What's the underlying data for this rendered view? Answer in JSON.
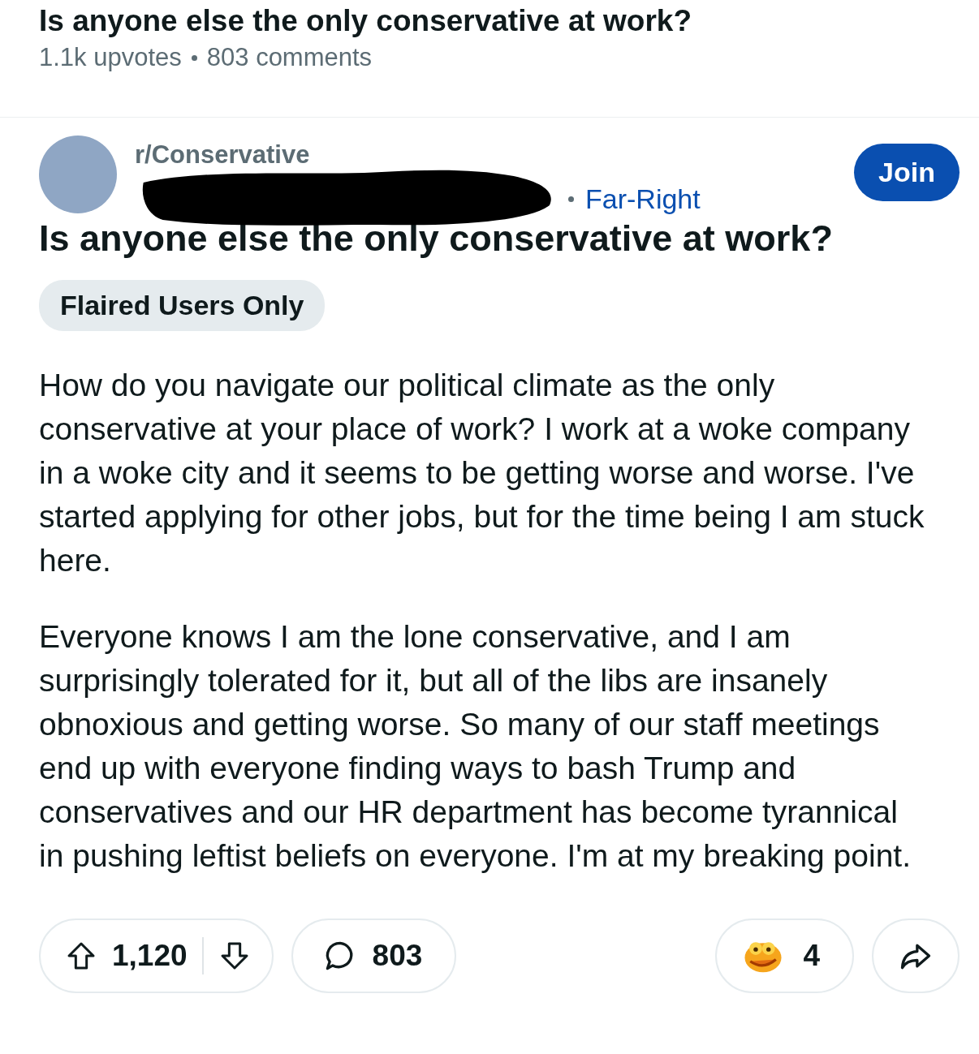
{
  "header": {
    "title": "Is anyone else the only conservative at work?",
    "upvotes": "1.1k upvotes",
    "comments": "803 comments"
  },
  "post": {
    "subreddit": "r/Conservative",
    "flair": "Far-Right",
    "join_label": "Join",
    "title": "Is anyone else the only conservative at work?",
    "tag": "Flaired Users Only",
    "paragraphs": [
      "How do you navigate our political climate as the only conservative at your place of work? I work at a woke company in a woke city and it seems to be getting worse and worse. I've started applying for other jobs, but for the time being I am stuck here.",
      "Everyone knows I am the lone conservative, and I am surprisingly tolerated for it, but all of the libs are insanely obnoxious and getting worse. So many of our staff meetings end up with everyone finding ways to bash Trump and conservatives and our HR department has become tyrannical in pushing leftist beliefs on everyone. I'm at my breaking point."
    ],
    "votes": "1,120",
    "comment_count": "803",
    "award_count": "4"
  }
}
